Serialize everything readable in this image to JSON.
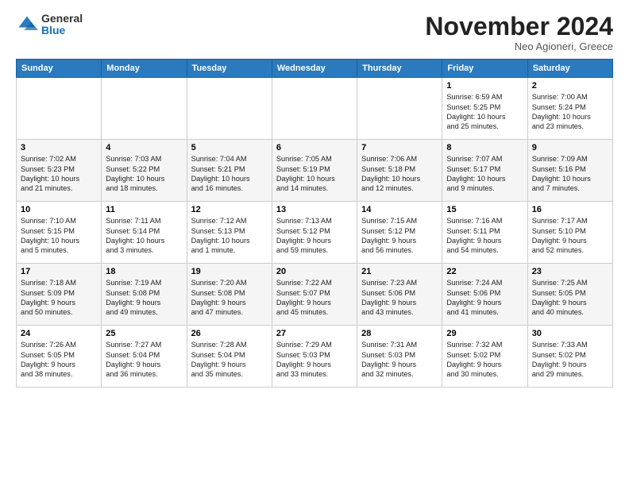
{
  "logo": {
    "general": "General",
    "blue": "Blue"
  },
  "header": {
    "month": "November 2024",
    "location": "Neo Agioneri, Greece"
  },
  "weekdays": [
    "Sunday",
    "Monday",
    "Tuesday",
    "Wednesday",
    "Thursday",
    "Friday",
    "Saturday"
  ],
  "weeks": [
    [
      {
        "day": "",
        "info": ""
      },
      {
        "day": "",
        "info": ""
      },
      {
        "day": "",
        "info": ""
      },
      {
        "day": "",
        "info": ""
      },
      {
        "day": "",
        "info": ""
      },
      {
        "day": "1",
        "info": "Sunrise: 6:59 AM\nSunset: 5:25 PM\nDaylight: 10 hours\nand 25 minutes."
      },
      {
        "day": "2",
        "info": "Sunrise: 7:00 AM\nSunset: 5:24 PM\nDaylight: 10 hours\nand 23 minutes."
      }
    ],
    [
      {
        "day": "3",
        "info": "Sunrise: 7:02 AM\nSunset: 5:23 PM\nDaylight: 10 hours\nand 21 minutes."
      },
      {
        "day": "4",
        "info": "Sunrise: 7:03 AM\nSunset: 5:22 PM\nDaylight: 10 hours\nand 18 minutes."
      },
      {
        "day": "5",
        "info": "Sunrise: 7:04 AM\nSunset: 5:21 PM\nDaylight: 10 hours\nand 16 minutes."
      },
      {
        "day": "6",
        "info": "Sunrise: 7:05 AM\nSunset: 5:19 PM\nDaylight: 10 hours\nand 14 minutes."
      },
      {
        "day": "7",
        "info": "Sunrise: 7:06 AM\nSunset: 5:18 PM\nDaylight: 10 hours\nand 12 minutes."
      },
      {
        "day": "8",
        "info": "Sunrise: 7:07 AM\nSunset: 5:17 PM\nDaylight: 10 hours\nand 9 minutes."
      },
      {
        "day": "9",
        "info": "Sunrise: 7:09 AM\nSunset: 5:16 PM\nDaylight: 10 hours\nand 7 minutes."
      }
    ],
    [
      {
        "day": "10",
        "info": "Sunrise: 7:10 AM\nSunset: 5:15 PM\nDaylight: 10 hours\nand 5 minutes."
      },
      {
        "day": "11",
        "info": "Sunrise: 7:11 AM\nSunset: 5:14 PM\nDaylight: 10 hours\nand 3 minutes."
      },
      {
        "day": "12",
        "info": "Sunrise: 7:12 AM\nSunset: 5:13 PM\nDaylight: 10 hours\nand 1 minute."
      },
      {
        "day": "13",
        "info": "Sunrise: 7:13 AM\nSunset: 5:12 PM\nDaylight: 9 hours\nand 59 minutes."
      },
      {
        "day": "14",
        "info": "Sunrise: 7:15 AM\nSunset: 5:12 PM\nDaylight: 9 hours\nand 56 minutes."
      },
      {
        "day": "15",
        "info": "Sunrise: 7:16 AM\nSunset: 5:11 PM\nDaylight: 9 hours\nand 54 minutes."
      },
      {
        "day": "16",
        "info": "Sunrise: 7:17 AM\nSunset: 5:10 PM\nDaylight: 9 hours\nand 52 minutes."
      }
    ],
    [
      {
        "day": "17",
        "info": "Sunrise: 7:18 AM\nSunset: 5:09 PM\nDaylight: 9 hours\nand 50 minutes."
      },
      {
        "day": "18",
        "info": "Sunrise: 7:19 AM\nSunset: 5:08 PM\nDaylight: 9 hours\nand 49 minutes."
      },
      {
        "day": "19",
        "info": "Sunrise: 7:20 AM\nSunset: 5:08 PM\nDaylight: 9 hours\nand 47 minutes."
      },
      {
        "day": "20",
        "info": "Sunrise: 7:22 AM\nSunset: 5:07 PM\nDaylight: 9 hours\nand 45 minutes."
      },
      {
        "day": "21",
        "info": "Sunrise: 7:23 AM\nSunset: 5:06 PM\nDaylight: 9 hours\nand 43 minutes."
      },
      {
        "day": "22",
        "info": "Sunrise: 7:24 AM\nSunset: 5:06 PM\nDaylight: 9 hours\nand 41 minutes."
      },
      {
        "day": "23",
        "info": "Sunrise: 7:25 AM\nSunset: 5:05 PM\nDaylight: 9 hours\nand 40 minutes."
      }
    ],
    [
      {
        "day": "24",
        "info": "Sunrise: 7:26 AM\nSunset: 5:05 PM\nDaylight: 9 hours\nand 38 minutes."
      },
      {
        "day": "25",
        "info": "Sunrise: 7:27 AM\nSunset: 5:04 PM\nDaylight: 9 hours\nand 36 minutes."
      },
      {
        "day": "26",
        "info": "Sunrise: 7:28 AM\nSunset: 5:04 PM\nDaylight: 9 hours\nand 35 minutes."
      },
      {
        "day": "27",
        "info": "Sunrise: 7:29 AM\nSunset: 5:03 PM\nDaylight: 9 hours\nand 33 minutes."
      },
      {
        "day": "28",
        "info": "Sunrise: 7:31 AM\nSunset: 5:03 PM\nDaylight: 9 hours\nand 32 minutes."
      },
      {
        "day": "29",
        "info": "Sunrise: 7:32 AM\nSunset: 5:02 PM\nDaylight: 9 hours\nand 30 minutes."
      },
      {
        "day": "30",
        "info": "Sunrise: 7:33 AM\nSunset: 5:02 PM\nDaylight: 9 hours\nand 29 minutes."
      }
    ]
  ]
}
